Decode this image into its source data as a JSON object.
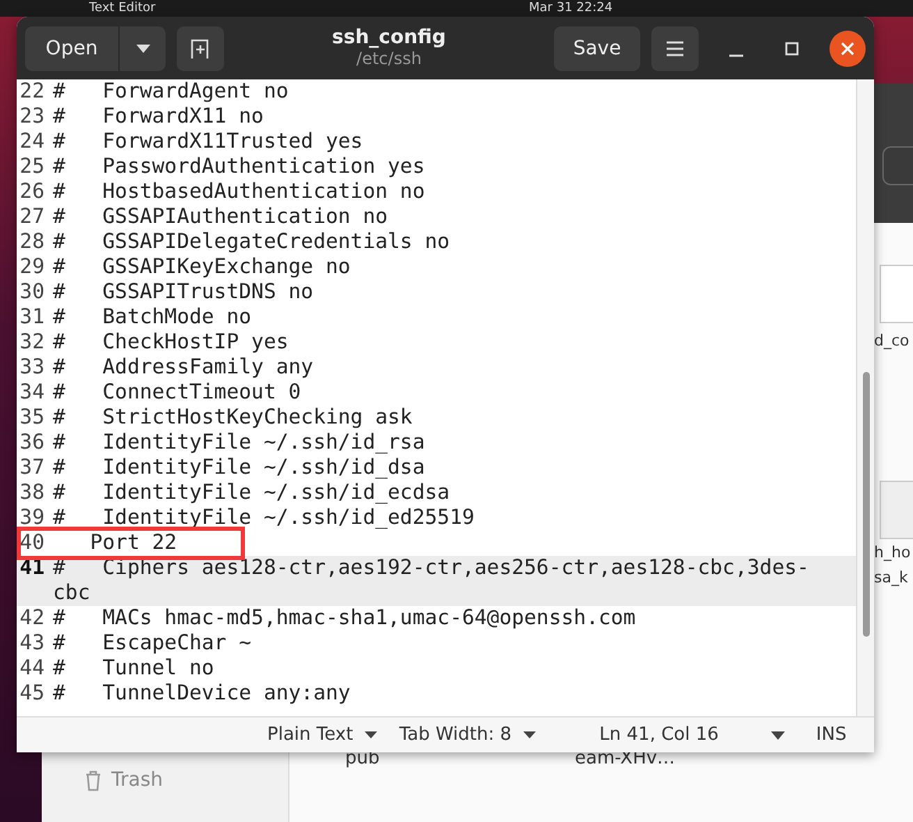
{
  "top_bar": {
    "app": "Text Editor",
    "clock": "Mar 31 22:24"
  },
  "window": {
    "title": "ssh_config",
    "subtitle": "/etc/ssh",
    "open_label": "Open",
    "save_label": "Save"
  },
  "lines": [
    {
      "number": "22",
      "text": "#   ForwardAgent no",
      "current": false
    },
    {
      "number": "23",
      "text": "#   ForwardX11 no",
      "current": false
    },
    {
      "number": "24",
      "text": "#   ForwardX11Trusted yes",
      "current": false
    },
    {
      "number": "25",
      "text": "#   PasswordAuthentication yes",
      "current": false
    },
    {
      "number": "26",
      "text": "#   HostbasedAuthentication no",
      "current": false
    },
    {
      "number": "27",
      "text": "#   GSSAPIAuthentication no",
      "current": false
    },
    {
      "number": "28",
      "text": "#   GSSAPIDelegateCredentials no",
      "current": false
    },
    {
      "number": "29",
      "text": "#   GSSAPIKeyExchange no",
      "current": false
    },
    {
      "number": "30",
      "text": "#   GSSAPITrustDNS no",
      "current": false
    },
    {
      "number": "31",
      "text": "#   BatchMode no",
      "current": false
    },
    {
      "number": "32",
      "text": "#   CheckHostIP yes",
      "current": false
    },
    {
      "number": "33",
      "text": "#   AddressFamily any",
      "current": false
    },
    {
      "number": "34",
      "text": "#   ConnectTimeout 0",
      "current": false
    },
    {
      "number": "35",
      "text": "#   StrictHostKeyChecking ask",
      "current": false
    },
    {
      "number": "36",
      "text": "#   IdentityFile ~/.ssh/id_rsa",
      "current": false
    },
    {
      "number": "37",
      "text": "#   IdentityFile ~/.ssh/id_dsa",
      "current": false
    },
    {
      "number": "38",
      "text": "#   IdentityFile ~/.ssh/id_ecdsa",
      "current": false
    },
    {
      "number": "39",
      "text": "#   IdentityFile ~/.ssh/id_ed25519",
      "current": false
    },
    {
      "number": "40",
      "text": "   Port 22",
      "current": false
    },
    {
      "number": "41",
      "text": "#   Ciphers aes128-ctr,aes192-ctr,aes256-ctr,aes128-cbc,3des-cbc",
      "current": true
    },
    {
      "number": "42",
      "text": "#   MACs hmac-md5,hmac-sha1,umac-64@openssh.com",
      "current": false
    },
    {
      "number": "43",
      "text": "#   EscapeChar ~",
      "current": false
    },
    {
      "number": "44",
      "text": "#   Tunnel no",
      "current": false
    },
    {
      "number": "45",
      "text": "#   TunnelDevice any:any",
      "current": false
    }
  ],
  "status_bar": {
    "language": "Plain Text",
    "tab_width": "Tab Width: 8",
    "position": "Ln 41, Col 16",
    "mode": "INS"
  },
  "behind": {
    "sidebar_item": "Trash",
    "files": [
      "pub",
      "eam-XHv…"
    ],
    "right_labels": [
      "d_co",
      "h_ho",
      "sa_k"
    ]
  }
}
